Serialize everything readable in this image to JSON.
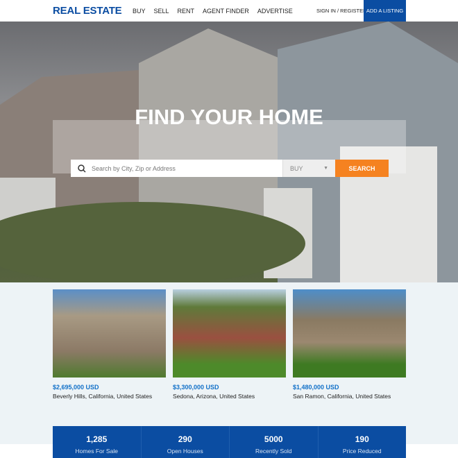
{
  "nav": {
    "logo": "REAL ESTATE",
    "items": [
      "BUY",
      "SELL",
      "RENT",
      "AGENT FINDER",
      "ADVERTISE"
    ],
    "signin": "SIGN IN / REGISTER",
    "add_listing": "ADD A LISTING"
  },
  "hero": {
    "title": "FIND YOUR HOME",
    "search_placeholder": "Search by City, Zip or Address",
    "select_value": "BUY",
    "search_button": "SEARCH"
  },
  "listings": [
    {
      "price": "$2,695,000 USD",
      "location": "Beverly Hills, California, United States"
    },
    {
      "price": "$3,300,000 USD",
      "location": "Sedona, Arizona, United States"
    },
    {
      "price": "$1,480,000 USD",
      "location": "San Ramon, California, United States"
    }
  ],
  "stats": [
    {
      "value": "1,285",
      "label": "Homes For Sale"
    },
    {
      "value": "290",
      "label": "Open Houses"
    },
    {
      "value": "5000",
      "label": "Recently Sold"
    },
    {
      "value": "190",
      "label": "Price Reduced"
    }
  ],
  "colors": {
    "brand": "#0b4da2",
    "accent": "#f58220",
    "price": "#1170c8"
  }
}
